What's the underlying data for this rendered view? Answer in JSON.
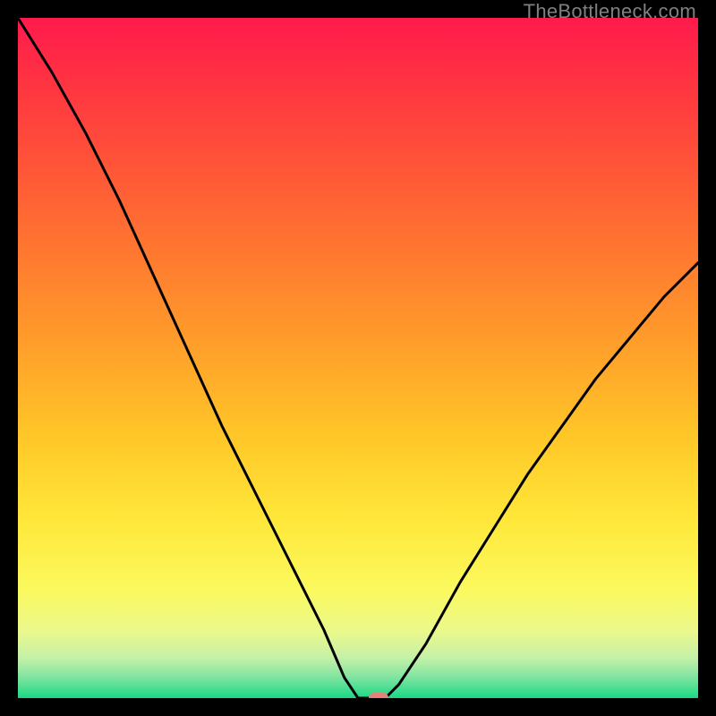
{
  "watermark": "TheBottleneck.com",
  "chart_data": {
    "type": "line",
    "title": "",
    "xlabel": "",
    "ylabel": "",
    "xlim": [
      0,
      100
    ],
    "ylim": [
      0,
      100
    ],
    "x": [
      0,
      5,
      10,
      15,
      20,
      25,
      30,
      35,
      40,
      45,
      48,
      50,
      52,
      54,
      56,
      60,
      65,
      70,
      75,
      80,
      85,
      90,
      95,
      100
    ],
    "y": [
      100,
      92,
      83,
      73,
      62,
      51,
      40,
      30,
      20,
      10,
      3,
      0,
      0,
      0,
      2,
      8,
      17,
      25,
      33,
      40,
      47,
      53,
      59,
      64
    ],
    "flat_zone": [
      48,
      54
    ],
    "marker": {
      "x": 53,
      "y": 0,
      "color": "#e8807a"
    },
    "gradient_stops": [
      {
        "offset": 0,
        "color": "#ff1a4c"
      },
      {
        "offset": 0.12,
        "color": "#ff3a3f"
      },
      {
        "offset": 0.3,
        "color": "#ff6b32"
      },
      {
        "offset": 0.48,
        "color": "#ff9e2a"
      },
      {
        "offset": 0.62,
        "color": "#ffc828"
      },
      {
        "offset": 0.74,
        "color": "#ffe83a"
      },
      {
        "offset": 0.84,
        "color": "#fbf95e"
      },
      {
        "offset": 0.9,
        "color": "#ecf98a"
      },
      {
        "offset": 0.94,
        "color": "#c6f1a8"
      },
      {
        "offset": 0.97,
        "color": "#7ee4a0"
      },
      {
        "offset": 1.0,
        "color": "#1ad884"
      }
    ]
  }
}
